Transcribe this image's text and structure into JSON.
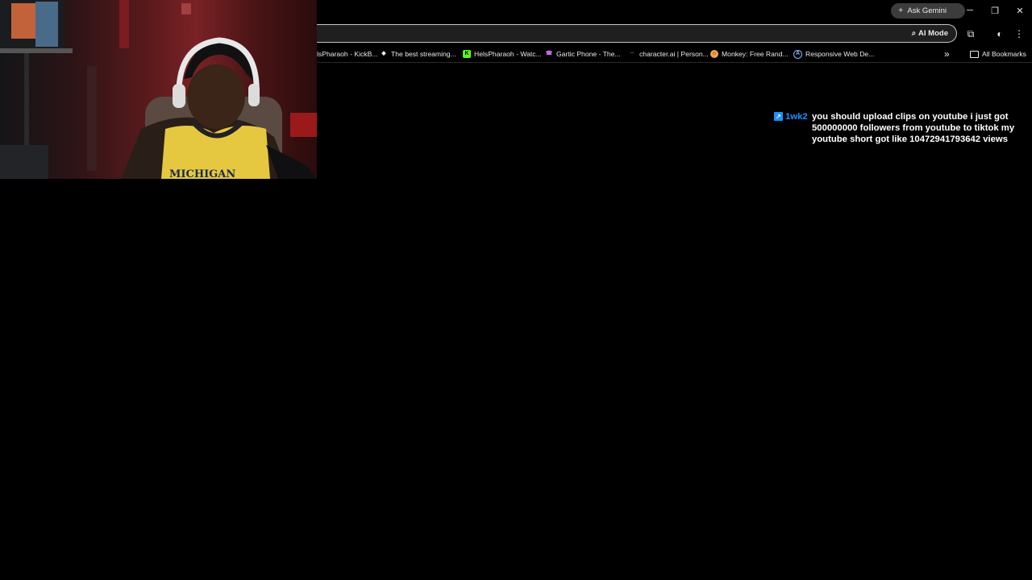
{
  "browser": {
    "ask_gemini": "Ask Gemini",
    "ai_mode": "AI Mode",
    "all_bookmarks": "All Bookmarks",
    "overflow_chevron": "»",
    "bookmarks": [
      {
        "label": "lsPharaoh - KickB...",
        "icon": "kick-icon",
        "icon_color": "#53fc18"
      },
      {
        "label": "The best streaming...",
        "icon": "streaming-site-icon",
        "icon_color": "#ffffff"
      },
      {
        "label": "HelsPharaoh - Watc...",
        "icon": "kick-k-icon",
        "icon_color": "#53fc18"
      },
      {
        "label": "Gartic Phone - The...",
        "icon": "gartic-phone-icon",
        "icon_color": "#c86cf0"
      },
      {
        "label": "character.ai | Person...",
        "icon": "character-ai-icon",
        "icon_color": "#9aa0a6"
      },
      {
        "label": "Monkey: Free Rand...",
        "icon": "monkey-icon",
        "icon_color": "#f4a64a"
      },
      {
        "label": "Responsive Web De...",
        "icon": "responsive-web-icon",
        "icon_color": "#8ab4f8"
      }
    ]
  },
  "chat": {
    "badge": "↗",
    "username": "1wk2",
    "username_color": "#1e90ff",
    "message": "you should upload clips on youtube i just got 500000000 followers from youtube to tiktok my youtube short got like 10472941793642 views"
  },
  "webcam": {
    "jersey_text": "MICHIGAN"
  }
}
